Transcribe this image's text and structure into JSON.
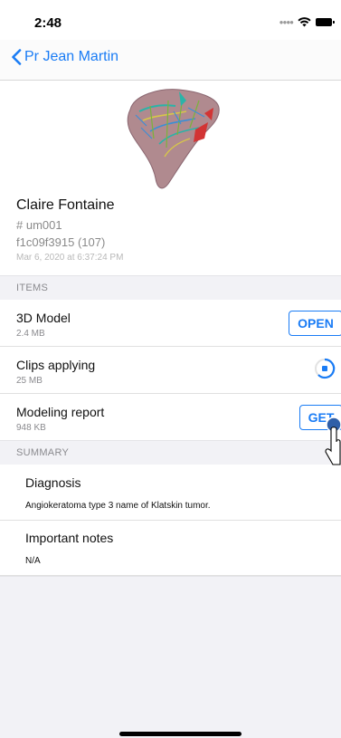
{
  "status_bar": {
    "time": "2:48",
    "signal_icon": "cellular-dots-icon",
    "wifi_icon": "wifi-icon",
    "battery_icon": "battery-icon"
  },
  "nav": {
    "back_label": "Pr Jean Martin",
    "back_icon": "chevron-left-icon"
  },
  "patient": {
    "name": "Claire Fontaine",
    "id": "# um001",
    "study": "f1c09f3915 (107)",
    "date": "Mar 6, 2020 at 6:37:24 PM"
  },
  "items_section": {
    "header": "ITEMS"
  },
  "items": [
    {
      "title": "3D Model",
      "size": "2.4 MB",
      "action": "OPEN"
    },
    {
      "title": "Clips applying",
      "size": "25 MB",
      "action": ""
    },
    {
      "title": "Modeling report",
      "size": "948 KB",
      "action": "GET"
    }
  ],
  "summary_section": {
    "header": "SUMMARY",
    "diagnosis_title": "Diagnosis",
    "diagnosis_text": "Angiokeratoma type 3 name of Klatskin tumor.",
    "notes_title": "Important notes",
    "notes_text": "N/A"
  },
  "colors": {
    "accent": "#1a7cf5",
    "section_bg": "#f2f2f6"
  }
}
